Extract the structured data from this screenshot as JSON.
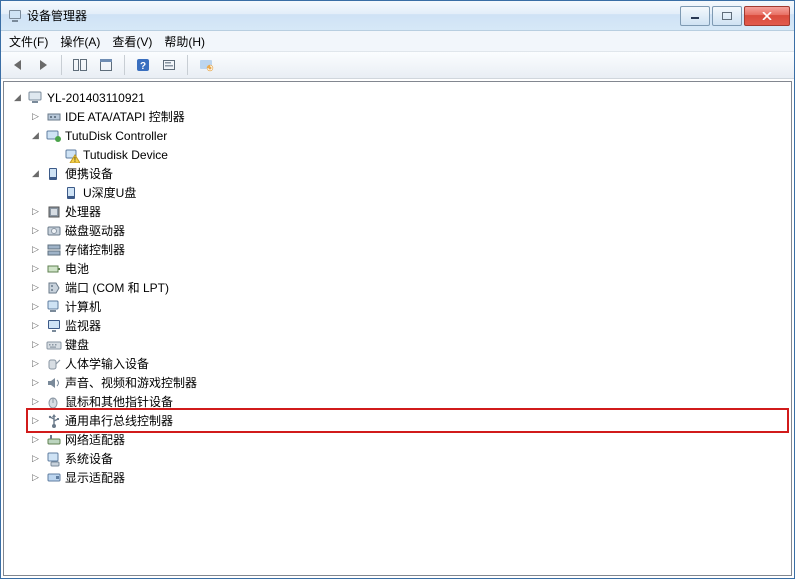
{
  "title": "设备管理器",
  "menu": {
    "file": "文件(F)",
    "action": "操作(A)",
    "view": "查看(V)",
    "help": "帮助(H)"
  },
  "tree": {
    "root": "YL-201403110921",
    "items": {
      "ide": "IDE ATA/ATAPI 控制器",
      "tutudisk_ctrl": "TutuDisk Controller",
      "tutudisk_dev": "Tutudisk Device",
      "portable": "便携设备",
      "udisk": "U深度U盘",
      "cpu": "处理器",
      "diskdrives": "磁盘驱动器",
      "storage": "存储控制器",
      "battery": "电池",
      "ports": "端口 (COM 和 LPT)",
      "computer": "计算机",
      "monitor": "监视器",
      "keyboard": "键盘",
      "hid": "人体学输入设备",
      "sound": "声音、视频和游戏控制器",
      "mouse": "鼠标和其他指针设备",
      "usb": "通用串行总线控制器",
      "network": "网络适配器",
      "system": "系统设备",
      "display": "显示适配器"
    }
  }
}
